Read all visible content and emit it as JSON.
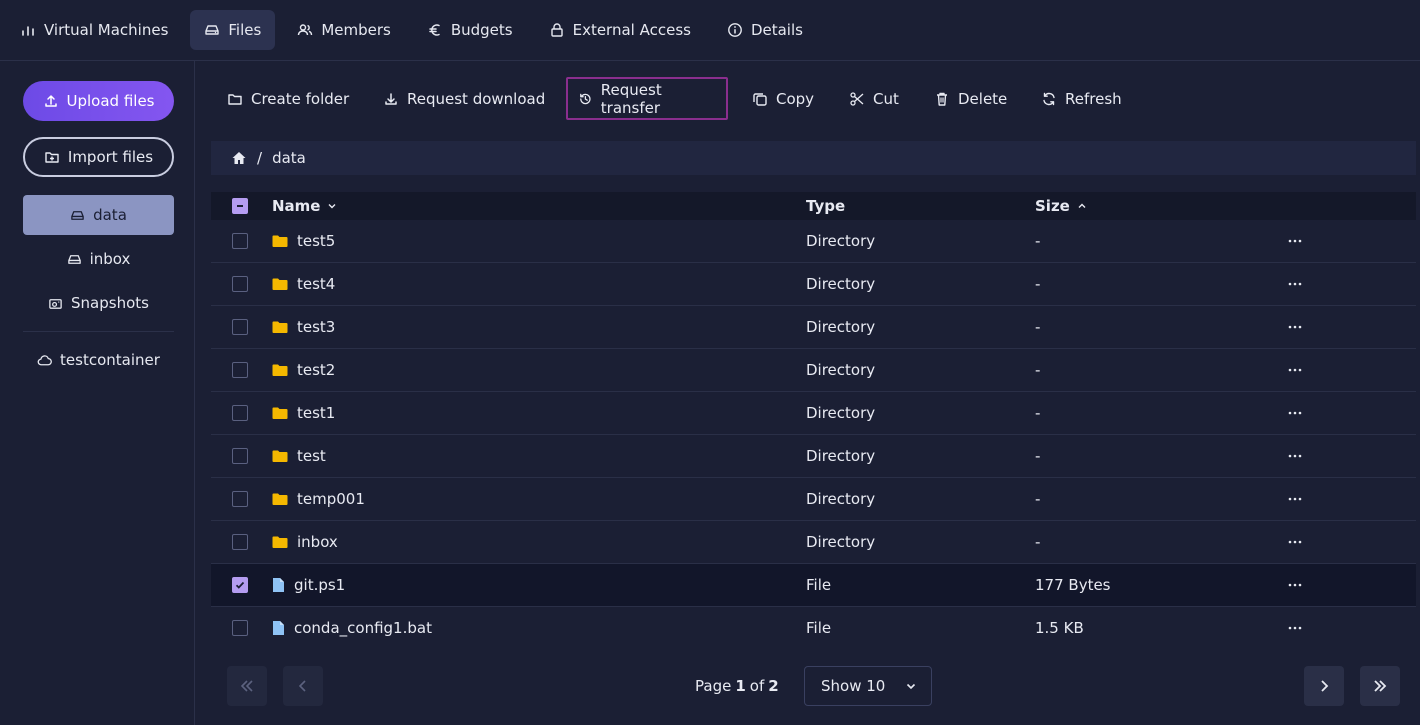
{
  "nav": {
    "tabs": [
      {
        "label": "Virtual Machines",
        "icon": "bar-chart-icon"
      },
      {
        "label": "Files",
        "icon": "drive-icon",
        "active": true
      },
      {
        "label": "Members",
        "icon": "users-icon"
      },
      {
        "label": "Budgets",
        "icon": "euro-icon"
      },
      {
        "label": "External Access",
        "icon": "lock-icon"
      },
      {
        "label": "Details",
        "icon": "info-icon"
      }
    ]
  },
  "sidebar": {
    "upload_label": "Upload files",
    "import_label": "Import files",
    "items": [
      {
        "label": "data",
        "icon": "drive-icon",
        "active": true
      },
      {
        "label": "inbox",
        "icon": "drive-icon"
      },
      {
        "label": "Snapshots",
        "icon": "snapshot-icon"
      },
      {
        "label": "testcontainer",
        "icon": "cloud-icon"
      }
    ]
  },
  "toolbar": {
    "create_folder": "Create folder",
    "request_download": "Request download",
    "request_transfer": "Request transfer",
    "copy": "Copy",
    "cut": "Cut",
    "delete": "Delete",
    "refresh": "Refresh"
  },
  "breadcrumb": {
    "separator": "/",
    "current": "data"
  },
  "table": {
    "headers": {
      "name": "Name",
      "type": "Type",
      "size": "Size"
    },
    "rows": [
      {
        "name": "test5",
        "type": "Directory",
        "size": "-",
        "kind": "folder",
        "selected": false
      },
      {
        "name": "test4",
        "type": "Directory",
        "size": "-",
        "kind": "folder",
        "selected": false
      },
      {
        "name": "test3",
        "type": "Directory",
        "size": "-",
        "kind": "folder",
        "selected": false
      },
      {
        "name": "test2",
        "type": "Directory",
        "size": "-",
        "kind": "folder",
        "selected": false
      },
      {
        "name": "test1",
        "type": "Directory",
        "size": "-",
        "kind": "folder",
        "selected": false
      },
      {
        "name": "test",
        "type": "Directory",
        "size": "-",
        "kind": "folder",
        "selected": false
      },
      {
        "name": "temp001",
        "type": "Directory",
        "size": "-",
        "kind": "folder",
        "selected": false
      },
      {
        "name": "inbox",
        "type": "Directory",
        "size": "-",
        "kind": "folder",
        "selected": false
      },
      {
        "name": "git.ps1",
        "type": "File",
        "size": "177 Bytes",
        "kind": "file",
        "selected": true
      },
      {
        "name": "conda_config1.bat",
        "type": "File",
        "size": "1.5 KB",
        "kind": "file",
        "selected": false
      }
    ]
  },
  "pager": {
    "page_prefix": "Page",
    "page_current": "1",
    "page_of": "of",
    "page_total": "2",
    "show_label": "Show 10"
  },
  "colors": {
    "background": "#1b1f34",
    "accent": "#7a50ec",
    "folder": "#f5b800",
    "file": "#8fc3f5",
    "checkbox": "#b49cf0",
    "highlight_border": "#8a2e8e"
  }
}
